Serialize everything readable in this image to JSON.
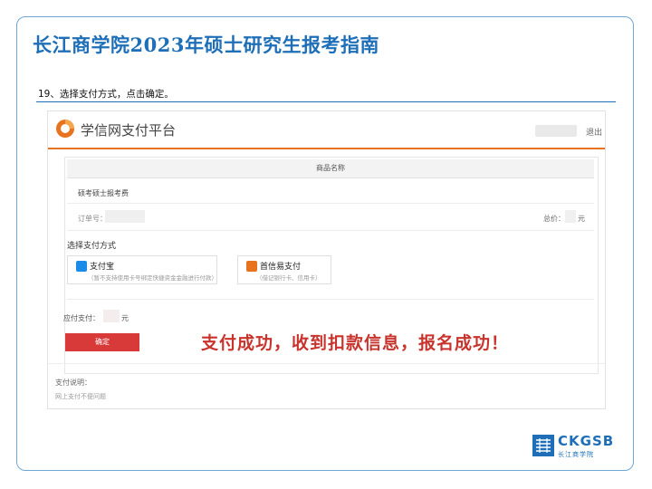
{
  "slide": {
    "title": "长江商学院2023年硕士研究生报考指南",
    "step_text": "19、选择支付方式，点击确定。",
    "callout": "支付成功，收到扣款信息，报名成功！"
  },
  "payment_page": {
    "logo_text": "学信网支付平台",
    "logout": "退出",
    "table_header": "商品名称",
    "item_name": "硕考硕士报考费",
    "order_label": "订单号：",
    "total_label": "总价：",
    "total_unit": "元",
    "pay_method_heading": "选择支付方式",
    "options": [
      {
        "name": "支付宝",
        "sub": "（暂不支持使用卡号绑定快捷资金金融进行付款）"
      },
      {
        "name": "首信易支付",
        "sub": "（借记银行卡、信用卡）"
      }
    ],
    "pay_amount_label": "应付支付：",
    "pay_amount_unit": "元",
    "confirm_button": "确定",
    "note_title": "支付说明：",
    "note_text": "网上支付不便问题"
  },
  "brand": {
    "top": "CKGSB",
    "bottom": "长江商学院"
  },
  "colors": {
    "title_blue": "#1e6fb8",
    "header_orange": "#e8731f",
    "confirm_red": "#d83a3a",
    "callout_red": "#c8342d"
  }
}
